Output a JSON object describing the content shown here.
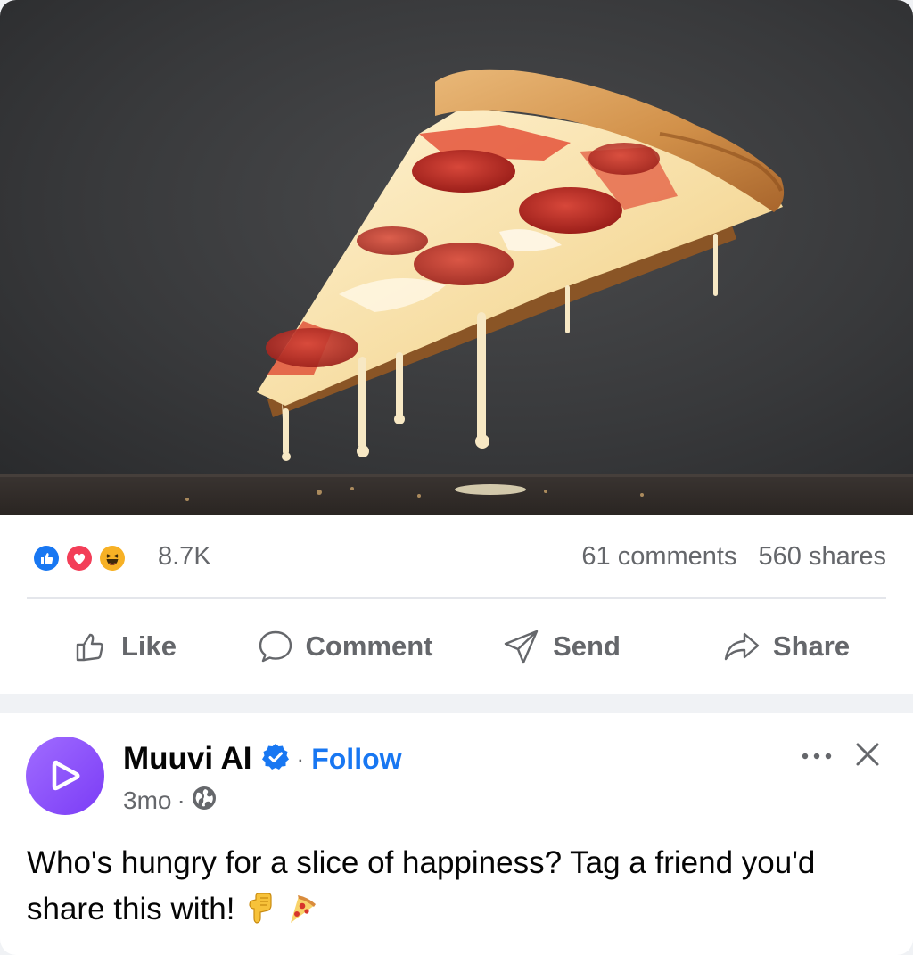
{
  "photo": {
    "alt_subject": "pepperoni-pizza-slice"
  },
  "stats": {
    "reactions": [
      "like",
      "love",
      "haha"
    ],
    "reaction_count": "8.7K",
    "comments": "61 comments",
    "shares": "560 shares"
  },
  "actions": {
    "like": "Like",
    "comment": "Comment",
    "send": "Send",
    "share": "Share"
  },
  "post": {
    "author": "Muuvi AI",
    "follow": "Follow",
    "separator": "·",
    "age": "3mo",
    "caption": "Who's hungry for a slice of happiness? Tag a friend you'd share this with!"
  },
  "colors": {
    "accent": "#1877f2",
    "muted": "#65676b",
    "like_blue": "#1877f2",
    "love_red": "#f33e58",
    "haha_yellow": "#f7b125",
    "avatar_purple": "#8b4cf7"
  },
  "icons": {
    "like": "thumbs-up-icon",
    "comment": "speech-bubble-icon",
    "send": "paper-plane-icon",
    "share": "share-arrow-icon",
    "verified": "verified-badge-icon",
    "privacy": "globe-icon",
    "more": "more-dots-icon",
    "close": "close-icon"
  }
}
